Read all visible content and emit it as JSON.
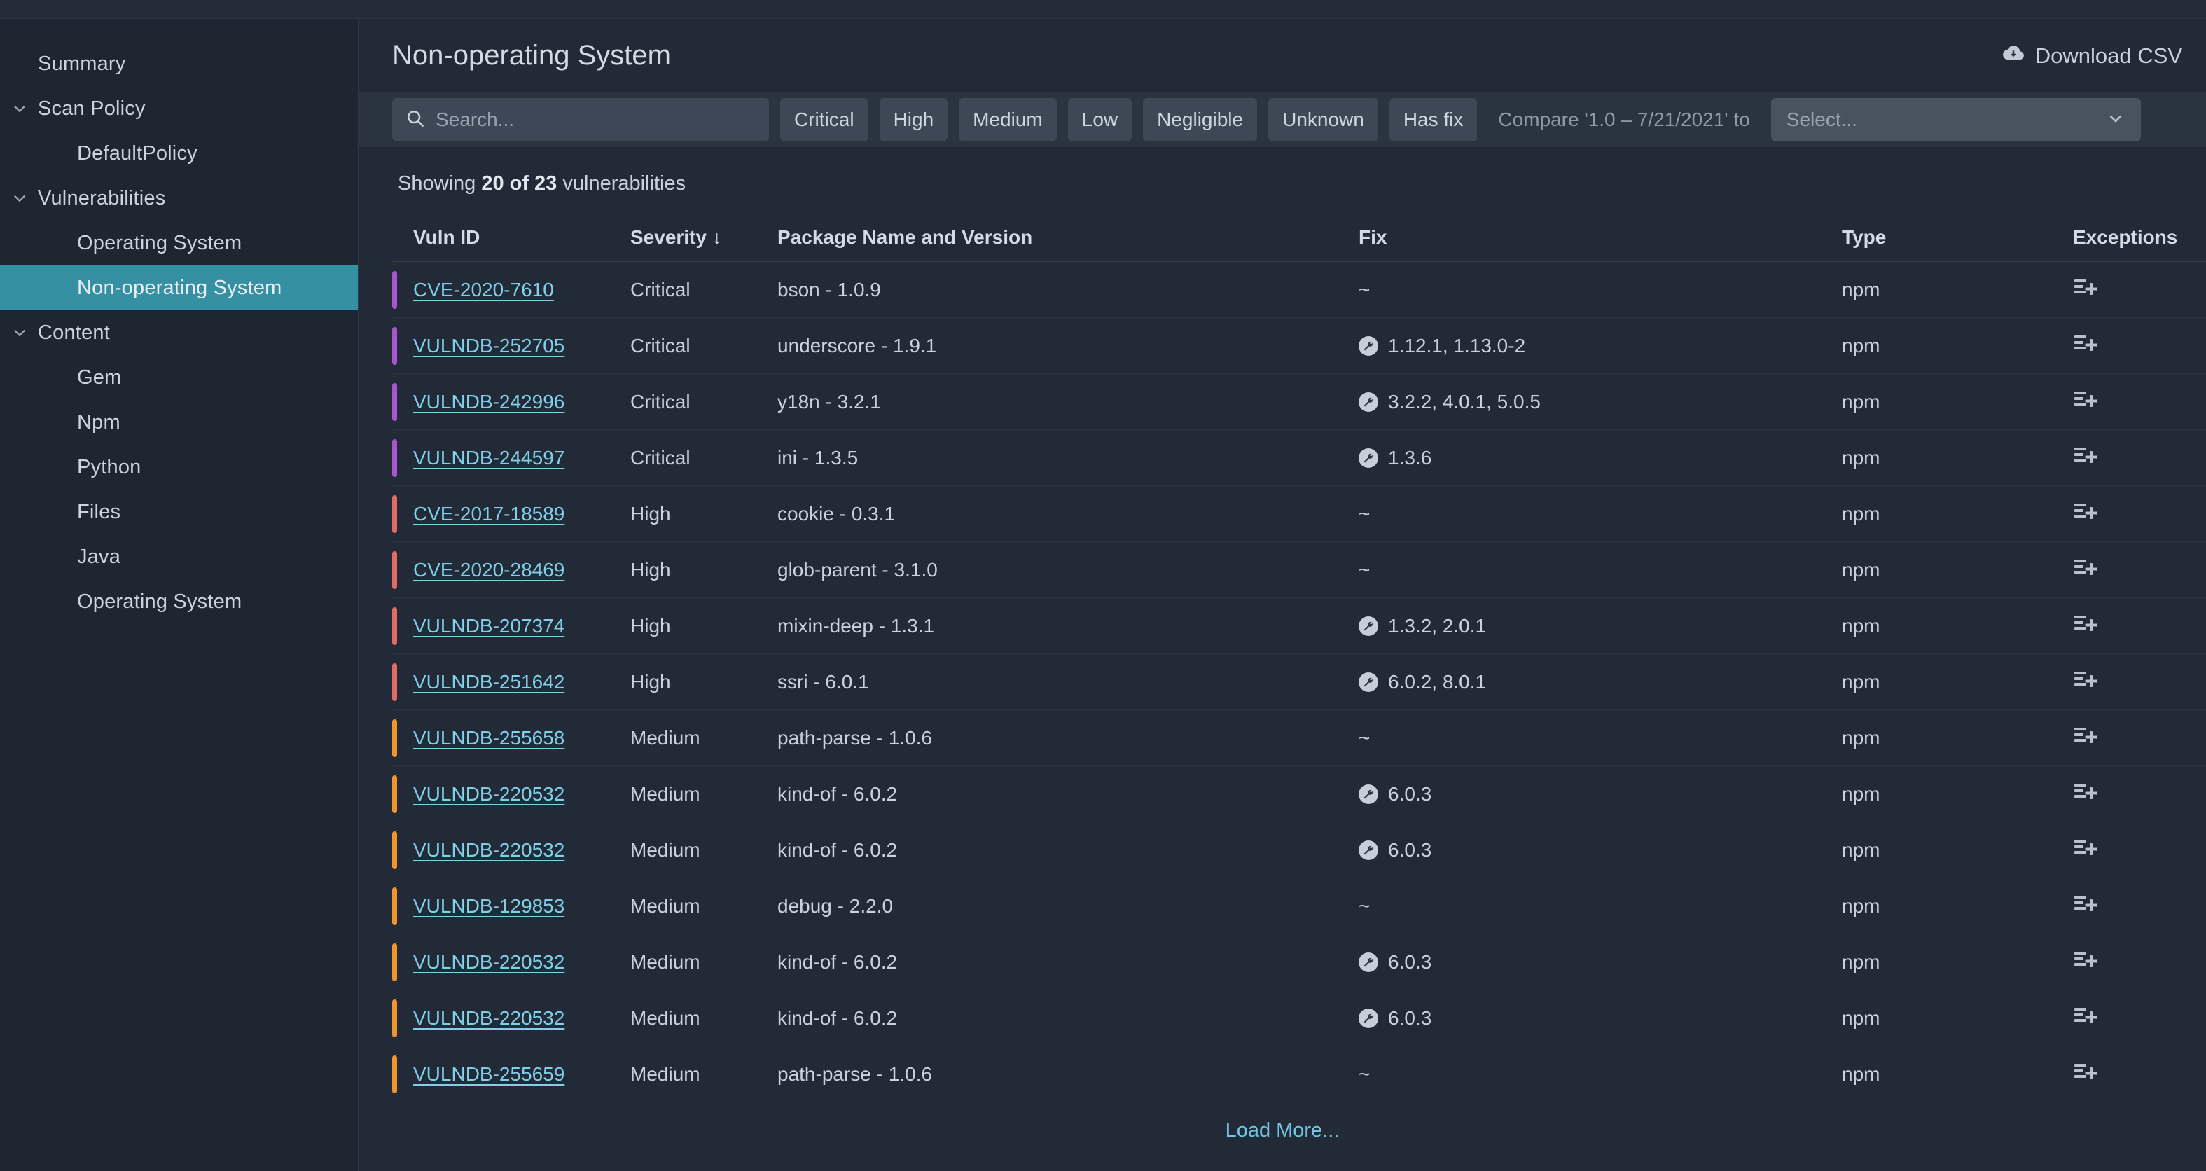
{
  "sidebar": {
    "items": [
      {
        "label": "Summary",
        "level": 0,
        "chevron": false,
        "active": false
      },
      {
        "label": "Scan Policy",
        "level": 0,
        "chevron": true,
        "active": false
      },
      {
        "label": "DefaultPolicy",
        "level": 1,
        "chevron": false,
        "active": false
      },
      {
        "label": "Vulnerabilities",
        "level": 0,
        "chevron": true,
        "active": false
      },
      {
        "label": "Operating System",
        "level": 1,
        "chevron": false,
        "active": false
      },
      {
        "label": "Non-operating System",
        "level": 1,
        "chevron": false,
        "active": true
      },
      {
        "label": "Content",
        "level": 0,
        "chevron": true,
        "active": false
      },
      {
        "label": "Gem",
        "level": 1,
        "chevron": false,
        "active": false
      },
      {
        "label": "Npm",
        "level": 1,
        "chevron": false,
        "active": false
      },
      {
        "label": "Python",
        "level": 1,
        "chevron": false,
        "active": false
      },
      {
        "label": "Files",
        "level": 1,
        "chevron": false,
        "active": false
      },
      {
        "label": "Java",
        "level": 1,
        "chevron": false,
        "active": false
      },
      {
        "label": "Operating System",
        "level": 1,
        "chevron": false,
        "active": false
      }
    ]
  },
  "header": {
    "title": "Non-operating System",
    "download_label": "Download CSV",
    "download_icon": "cloud-download-icon"
  },
  "filters": {
    "search_placeholder": "Search...",
    "search_value": "",
    "search_icon": "search-icon",
    "buttons": [
      {
        "label": "Critical"
      },
      {
        "label": "High"
      },
      {
        "label": "Medium"
      },
      {
        "label": "Low"
      },
      {
        "label": "Negligible"
      },
      {
        "label": "Unknown"
      },
      {
        "label": "Has fix"
      }
    ],
    "compare_label": "Compare '1.0 – 7/21/2021' to",
    "select_placeholder": "Select...",
    "select_value": ""
  },
  "summary": {
    "prefix": "Showing ",
    "count": "20 of 23",
    "suffix": " vulnerabilities"
  },
  "table": {
    "columns": [
      {
        "key": "vuln",
        "label": "Vuln ID"
      },
      {
        "key": "sev",
        "label": "Severity ↓"
      },
      {
        "key": "pkg",
        "label": "Package Name and Version"
      },
      {
        "key": "fix",
        "label": "Fix"
      },
      {
        "key": "type",
        "label": "Type"
      },
      {
        "key": "exc",
        "label": "Exceptions"
      }
    ],
    "rows": [
      {
        "vuln": "CVE-2020-7610",
        "severity": "Critical",
        "package": "bson - 1.0.9",
        "fix": "~",
        "has_fix": false,
        "type": "npm"
      },
      {
        "vuln": "VULNDB-252705",
        "severity": "Critical",
        "package": "underscore - 1.9.1",
        "fix": "1.12.1, 1.13.0-2",
        "has_fix": true,
        "type": "npm"
      },
      {
        "vuln": "VULNDB-242996",
        "severity": "Critical",
        "package": "y18n - 3.2.1",
        "fix": "3.2.2, 4.0.1, 5.0.5",
        "has_fix": true,
        "type": "npm"
      },
      {
        "vuln": "VULNDB-244597",
        "severity": "Critical",
        "package": "ini - 1.3.5",
        "fix": "1.3.6",
        "has_fix": true,
        "type": "npm"
      },
      {
        "vuln": "CVE-2017-18589",
        "severity": "High",
        "package": "cookie - 0.3.1",
        "fix": "~",
        "has_fix": false,
        "type": "npm"
      },
      {
        "vuln": "CVE-2020-28469",
        "severity": "High",
        "package": "glob-parent - 3.1.0",
        "fix": "~",
        "has_fix": false,
        "type": "npm"
      },
      {
        "vuln": "VULNDB-207374",
        "severity": "High",
        "package": "mixin-deep - 1.3.1",
        "fix": "1.3.2, 2.0.1",
        "has_fix": true,
        "type": "npm"
      },
      {
        "vuln": "VULNDB-251642",
        "severity": "High",
        "package": "ssri - 6.0.1",
        "fix": "6.0.2, 8.0.1",
        "has_fix": true,
        "type": "npm"
      },
      {
        "vuln": "VULNDB-255658",
        "severity": "Medium",
        "package": "path-parse - 1.0.6",
        "fix": "~",
        "has_fix": false,
        "type": "npm"
      },
      {
        "vuln": "VULNDB-220532",
        "severity": "Medium",
        "package": "kind-of - 6.0.2",
        "fix": "6.0.3",
        "has_fix": true,
        "type": "npm"
      },
      {
        "vuln": "VULNDB-220532",
        "severity": "Medium",
        "package": "kind-of - 6.0.2",
        "fix": "6.0.3",
        "has_fix": true,
        "type": "npm"
      },
      {
        "vuln": "VULNDB-129853",
        "severity": "Medium",
        "package": "debug - 2.2.0",
        "fix": "~",
        "has_fix": false,
        "type": "npm"
      },
      {
        "vuln": "VULNDB-220532",
        "severity": "Medium",
        "package": "kind-of - 6.0.2",
        "fix": "6.0.3",
        "has_fix": true,
        "type": "npm"
      },
      {
        "vuln": "VULNDB-220532",
        "severity": "Medium",
        "package": "kind-of - 6.0.2",
        "fix": "6.0.3",
        "has_fix": true,
        "type": "npm"
      },
      {
        "vuln": "VULNDB-255659",
        "severity": "Medium",
        "package": "path-parse - 1.0.6",
        "fix": "~",
        "has_fix": false,
        "type": "npm"
      }
    ],
    "exception_icon": "add-to-list-icon",
    "fix_icon": "wrench-icon"
  },
  "footer": {
    "load_more_label": "Load More..."
  },
  "colors": {
    "severity_critical": "#a855d0",
    "severity_high": "#e06c63",
    "severity_medium": "#f0952e",
    "accent_teal": "#3590a4",
    "link": "#7fd0e8",
    "page_bg": "#212a36",
    "sidebar_bg": "#1e2631",
    "filterbar_bg": "#2a3441"
  }
}
